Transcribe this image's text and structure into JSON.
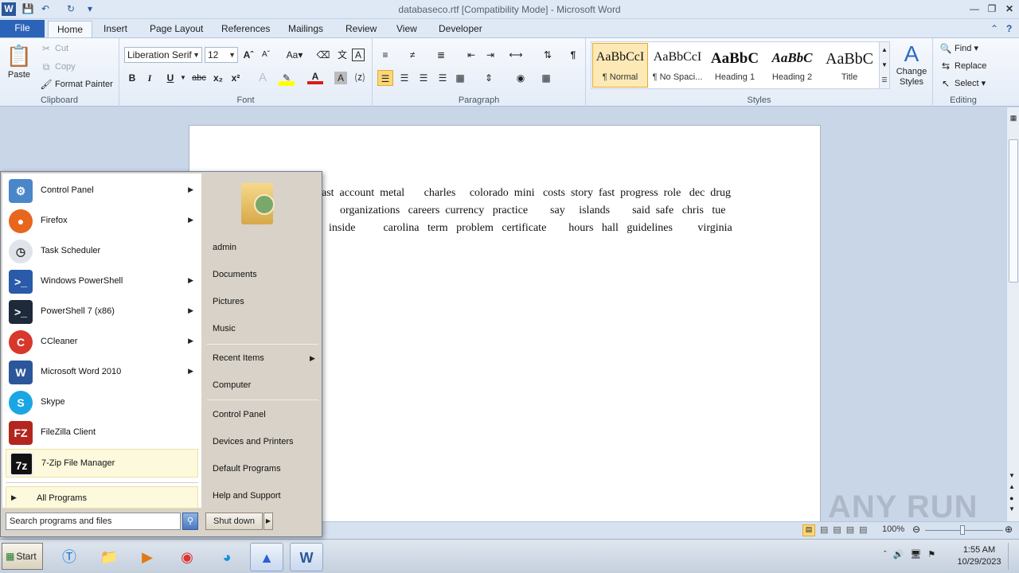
{
  "window": {
    "title": "databaseco.rtf [Compatibility Mode]  -  Microsoft Word"
  },
  "tabs": [
    "File",
    "Home",
    "Insert",
    "Page Layout",
    "References",
    "Mailings",
    "Review",
    "View",
    "Developer"
  ],
  "ribbon": {
    "clipboard": {
      "paste": "Paste",
      "cut": "Cut",
      "copy": "Copy",
      "format_painter": "Format Painter",
      "label": "Clipboard"
    },
    "font": {
      "family": "Liberation Serif",
      "size": "12",
      "label": "Font"
    },
    "paragraph": {
      "label": "Paragraph"
    },
    "styles": {
      "items": [
        {
          "sample": "AaBbCcI",
          "name": "¶ Normal"
        },
        {
          "sample": "AaBbCcI",
          "name": "¶ No Spaci..."
        },
        {
          "sample": "AaBbC",
          "name": "Heading 1"
        },
        {
          "sample": "AaBbC",
          "name": "Heading 2"
        },
        {
          "sample": "AaBbC",
          "name": "Title"
        }
      ],
      "change_styles": "Change Styles",
      "label": "Styles"
    },
    "editing": {
      "find": "Find",
      "replace": "Replace",
      "select": "Select",
      "label": "Editing"
    }
  },
  "document": {
    "lines": [
      "ast  account  metal       charles     colorado  mini   costs  story  fast  progress  role   dec  drug",
      "organizations   careers  currency   practice        say     islands        said  safe   chris   tue",
      "inside          carolina   term   problem   certificate        hours   hall   guidelines         virginia"
    ]
  },
  "statusbar": {
    "zoom": "100%"
  },
  "watermark": "ANY RUN",
  "start_menu": {
    "programs": [
      {
        "label": "Control Panel",
        "has_submenu": true,
        "icon": "control-panel-icon"
      },
      {
        "label": "Firefox",
        "has_submenu": true,
        "icon": "firefox-icon"
      },
      {
        "label": "Task Scheduler",
        "has_submenu": false,
        "icon": "task-scheduler-icon"
      },
      {
        "label": "Windows PowerShell",
        "has_submenu": true,
        "icon": "powershell-icon"
      },
      {
        "label": "PowerShell 7 (x86)",
        "has_submenu": true,
        "icon": "powershell7-icon"
      },
      {
        "label": "CCleaner",
        "has_submenu": true,
        "icon": "ccleaner-icon"
      },
      {
        "label": "Microsoft Word 2010",
        "has_submenu": true,
        "icon": "word-icon"
      },
      {
        "label": "Skype",
        "has_submenu": false,
        "icon": "skype-icon"
      },
      {
        "label": "FileZilla Client",
        "has_submenu": false,
        "icon": "filezilla-icon"
      },
      {
        "label": "7-Zip File Manager",
        "has_submenu": false,
        "icon": "7zip-icon"
      }
    ],
    "all_programs": "All Programs",
    "search_placeholder": "Search programs and files",
    "right_items": [
      "admin",
      "Documents",
      "Pictures",
      "Music",
      "Recent Items",
      "Computer",
      "Control Panel",
      "Devices and Printers",
      "Default Programs",
      "Help and Support"
    ],
    "shutdown": "Shut down"
  },
  "taskbar": {
    "start": "Start",
    "time": "1:55 AM",
    "date": "10/29/2023"
  }
}
